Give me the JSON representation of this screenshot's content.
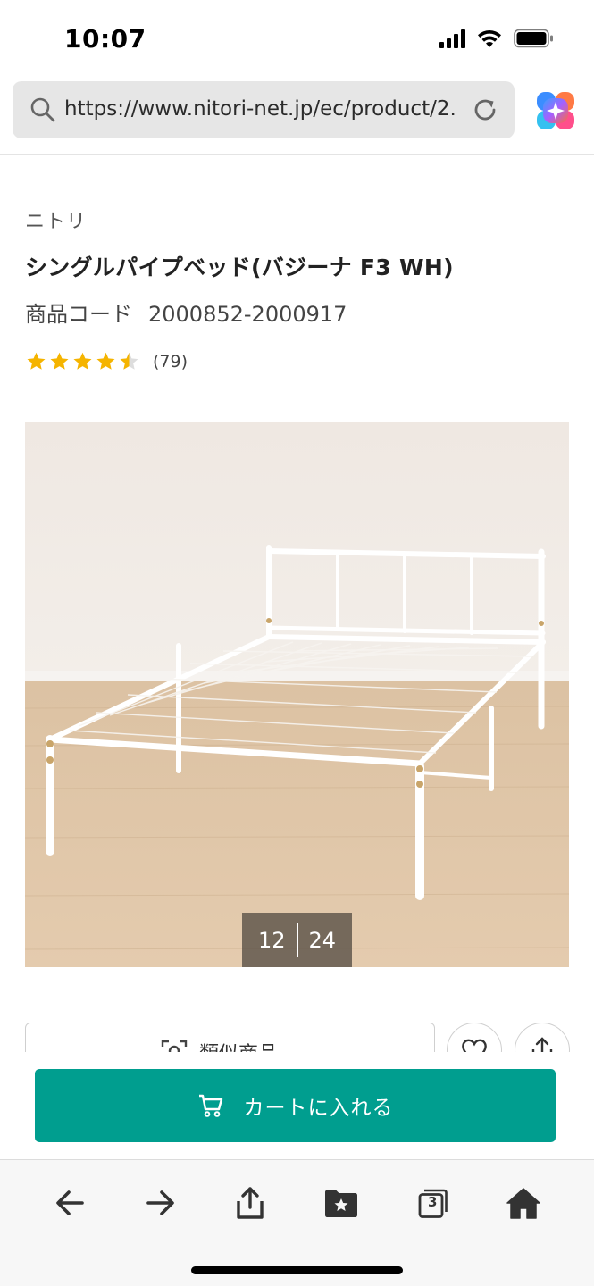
{
  "status_bar": {
    "time": "10:07",
    "icons": [
      "signal-icon",
      "wifi-icon",
      "battery-icon"
    ]
  },
  "browser": {
    "url": "https://www.nitori-net.jp/ec/product/2...",
    "icons": [
      "search-icon",
      "reload-icon",
      "ai-assistant-icon"
    ]
  },
  "product": {
    "brand": "ニトリ",
    "title": "シングルパイプベッド(バジーナ F3 WH)",
    "code_label": "商品コード",
    "code_value": "2000852-2000917",
    "rating": 4.5,
    "review_count": "(79)",
    "star_color": "#f5b400"
  },
  "gallery": {
    "current": "12",
    "total": "24"
  },
  "actions": {
    "similar_label": "類似商品",
    "cart_label": "カートに入れる",
    "accent_color": "#009e8f"
  },
  "toolbar": {
    "tabs_count": "3",
    "icons": [
      "back-arrow-icon",
      "forward-arrow-icon",
      "share-icon",
      "bookmarks-icon",
      "tabs-icon",
      "home-icon"
    ]
  }
}
